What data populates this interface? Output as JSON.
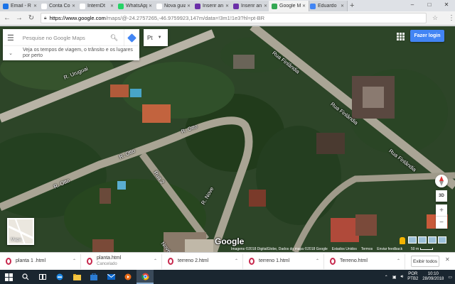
{
  "browser": {
    "tabs": [
      {
        "label": "Email - R",
        "color": "#1a73e8",
        "active": false
      },
      {
        "label": "Conta Co",
        "color": "#ffffff",
        "active": false
      },
      {
        "label": "InternDt",
        "color": "#ffffff",
        "active": false
      },
      {
        "label": "WhatsApp",
        "color": "#25d366",
        "active": false
      },
      {
        "label": "Nova guia",
        "color": "#ffffff",
        "active": false
      },
      {
        "label": "Inserir an",
        "color": "#6b2fa8",
        "active": false
      },
      {
        "label": "Inserir an",
        "color": "#6b2fa8",
        "active": false
      },
      {
        "label": "Google M",
        "color": "#34a853",
        "active": true
      },
      {
        "label": "Eduardo",
        "color": "#4285f4",
        "active": false
      }
    ],
    "new_tab": "+",
    "url_domain": "https://www.google.com",
    "url_rest": "/maps/@-24.2757265,-46.9759923,147m/data=!3m1!1e3?hl=pt-BR"
  },
  "maps": {
    "search_placeholder": "Pesquise no Google Maps",
    "language": "Pt",
    "traffic_hint": "Veja os tempos de viagem, o trânsito e os lugares por perto",
    "login_button": "Fazer login",
    "minimap_label": "Mapa",
    "logo": "Google",
    "btn_3d": "3D",
    "zoom_in": "+",
    "zoom_out": "−",
    "footer": [
      "Imagens ©2018 DigitalGlobe, Dados do mapa ©2018 Google",
      "Estados Unidos",
      "Termos",
      "Enviar feedback"
    ],
    "scale": "50 m",
    "road_labels": [
      "R. Uruguai",
      "Rua Finlândia",
      "Rua Finlândia",
      "Rua Finlândia",
      "R. Otto",
      "R. Otto",
      "R. Otto",
      "Rua 2",
      "R. Nove",
      "Nove"
    ]
  },
  "downloads": {
    "items": [
      {
        "name": "planta 1 .html",
        "sub": ""
      },
      {
        "name": "planta.html",
        "sub": "Cancelado"
      },
      {
        "name": "terreno 2.html",
        "sub": ""
      },
      {
        "name": "terreno 1.html",
        "sub": ""
      },
      {
        "name": "Terreno.html",
        "sub": ""
      }
    ],
    "show_all": "Exibir todos"
  },
  "taskbar": {
    "lang": "POR",
    "lang2": "PTB2",
    "time": "10:10",
    "date": "28/09/2018"
  }
}
